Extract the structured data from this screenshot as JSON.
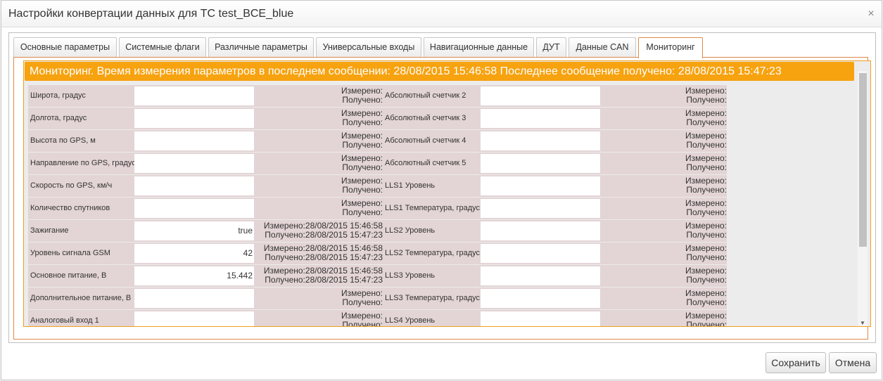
{
  "dialog": {
    "title": "Настройки конвертации данных для ТС test_BCE_blue",
    "close_glyph": "×"
  },
  "tabs": [
    {
      "label": "Основные параметры"
    },
    {
      "label": "Системные флаги"
    },
    {
      "label": "Различные параметры"
    },
    {
      "label": "Универсальные входы"
    },
    {
      "label": "Навигационные данные"
    },
    {
      "label": "ДУТ"
    },
    {
      "label": "Данные CAN"
    },
    {
      "label": "Мониторинг",
      "active": true
    }
  ],
  "monitoring": {
    "header": "Мониторинг. Время измерения параметров в последнем сообщении: 28/08/2015 15:46:58 Последнее сообщение получено: 28/08/2015 15:47:23",
    "measured_label": "Измерено:",
    "received_label": "Получено:",
    "left_rows": [
      {
        "label": "Широта, градус",
        "value": "",
        "measured": "",
        "received": ""
      },
      {
        "label": "Долгота, градус",
        "value": "",
        "measured": "",
        "received": ""
      },
      {
        "label": "Высота по GPS, м",
        "value": "",
        "measured": "",
        "received": ""
      },
      {
        "label": "Направление по GPS, градус",
        "value": "",
        "measured": "",
        "received": ""
      },
      {
        "label": "Скорость по GPS, км/ч",
        "value": "",
        "measured": "",
        "received": ""
      },
      {
        "label": "Количество спутников",
        "value": "",
        "measured": "",
        "received": ""
      },
      {
        "label": "Зажигание",
        "value": "true",
        "measured": "28/08/2015 15:46:58",
        "received": "28/08/2015 15:47:23"
      },
      {
        "label": "Уровень сигнала GSM",
        "value": "42",
        "measured": "28/08/2015 15:46:58",
        "received": "28/08/2015 15:47:23"
      },
      {
        "label": "Основное питание, В",
        "value": "15.442",
        "measured": "28/08/2015 15:46:58",
        "received": "28/08/2015 15:47:23"
      },
      {
        "label": "Дополнительное питание, В",
        "value": "",
        "measured": "",
        "received": ""
      },
      {
        "label": "Аналоговый вход 1",
        "value": "",
        "measured": "",
        "received": ""
      }
    ],
    "right_rows": [
      {
        "label": "Абсолютный счетчик 2",
        "value": ""
      },
      {
        "label": "Абсолютный счетчик 3",
        "value": ""
      },
      {
        "label": "Абсолютный счетчик 4",
        "value": ""
      },
      {
        "label": "Абсолютный счетчик 5",
        "value": ""
      },
      {
        "label": "LLS1 Уровень",
        "value": ""
      },
      {
        "label": "LLS1 Температура, градус",
        "value": ""
      },
      {
        "label": "LLS2 Уровень",
        "value": ""
      },
      {
        "label": "LLS2 Температура, градус",
        "value": ""
      },
      {
        "label": "LLS3 Уровень",
        "value": ""
      },
      {
        "label": "LLS3 Температура, градус",
        "value": ""
      },
      {
        "label": "LLS4 Уровень",
        "value": ""
      }
    ]
  },
  "scrollbar": {
    "up_glyph": "▲",
    "down_glyph": "▼"
  },
  "buttons": {
    "save": "Сохранить",
    "cancel": "Отмена"
  },
  "colors": {
    "accent_orange": "#f7a20f",
    "tab_border": "#e0884a",
    "row_bg": "#e3d4d5"
  }
}
